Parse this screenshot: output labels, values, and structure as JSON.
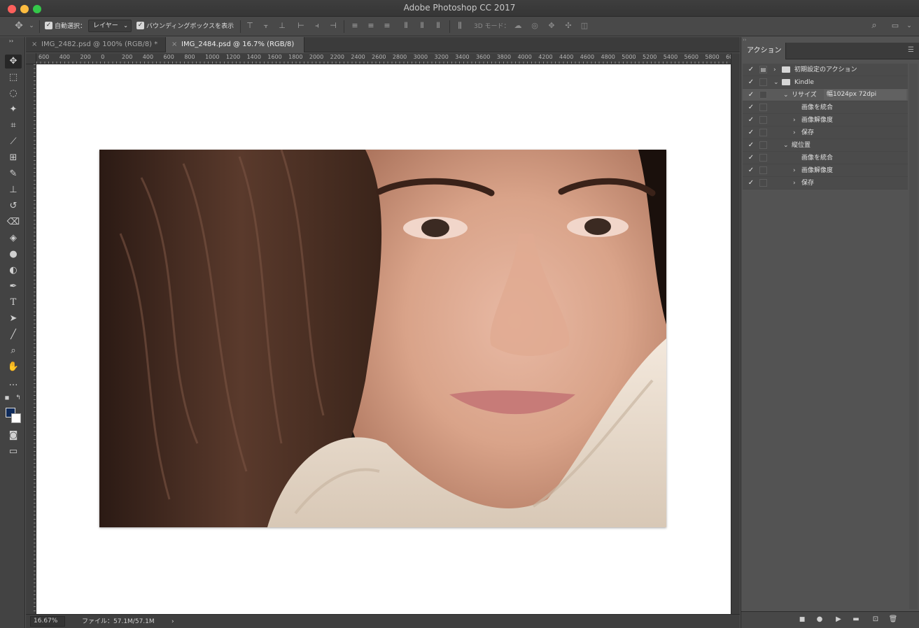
{
  "window": {
    "title": "Adobe Photoshop CC 2017"
  },
  "optionsbar": {
    "auto_select_label": "自動選択：",
    "auto_select_value": "レイヤー",
    "bounding_box_label": "バウンディングボックスを表示",
    "mode_3d_label": "3D モード："
  },
  "tabs": [
    {
      "label": "IMG_2482.psd @ 100% (RGB/8) *",
      "active": false
    },
    {
      "label": "IMG_2484.psd @ 16.7% (RGB/8)",
      "active": true
    }
  ],
  "ruler": {
    "h_labels": [
      "600",
      "400",
      "200",
      "0",
      "200",
      "400",
      "600",
      "800",
      "1000",
      "1200",
      "1400",
      "1600",
      "1800",
      "2000",
      "2200",
      "2400",
      "2600",
      "2800",
      "3000",
      "3200",
      "3400",
      "3600",
      "3800",
      "4000",
      "4200",
      "4400",
      "4600",
      "4800",
      "5000",
      "5200",
      "5400",
      "5600",
      "5800",
      "60"
    ]
  },
  "status": {
    "zoom": "16.67%",
    "file_info": "ファイル：57.1M/57.1M"
  },
  "panel": {
    "tab_label": "アクション",
    "actions": [
      {
        "checked": true,
        "dialog": true,
        "indent": 0,
        "twisty": "right",
        "folder": true,
        "label": "初期設定のアクション"
      },
      {
        "checked": true,
        "dialog": false,
        "indent": 0,
        "twisty": "down",
        "folder": true,
        "label": "Kindle"
      },
      {
        "checked": true,
        "dialog": false,
        "indent": 1,
        "twisty": "down",
        "folder": false,
        "label": "リサイズ",
        "value": "幅1024px 72dpi",
        "selected": true
      },
      {
        "checked": true,
        "dialog": false,
        "indent": 2,
        "twisty": "",
        "folder": false,
        "label": "画像を統合"
      },
      {
        "checked": true,
        "dialog": false,
        "indent": 2,
        "twisty": "right",
        "folder": false,
        "label": "画像解像度"
      },
      {
        "checked": true,
        "dialog": false,
        "indent": 2,
        "twisty": "right",
        "folder": false,
        "label": "保存"
      },
      {
        "checked": true,
        "dialog": false,
        "indent": 1,
        "twisty": "down",
        "folder": false,
        "label": "縦位置"
      },
      {
        "checked": true,
        "dialog": false,
        "indent": 2,
        "twisty": "",
        "folder": false,
        "label": "画像を統合"
      },
      {
        "checked": true,
        "dialog": false,
        "indent": 2,
        "twisty": "right",
        "folder": false,
        "label": "画像解像度"
      },
      {
        "checked": true,
        "dialog": false,
        "indent": 2,
        "twisty": "right",
        "folder": false,
        "label": "保存"
      }
    ]
  },
  "colors": {
    "foreground": "#0f2b5b",
    "background": "#ffffff"
  }
}
